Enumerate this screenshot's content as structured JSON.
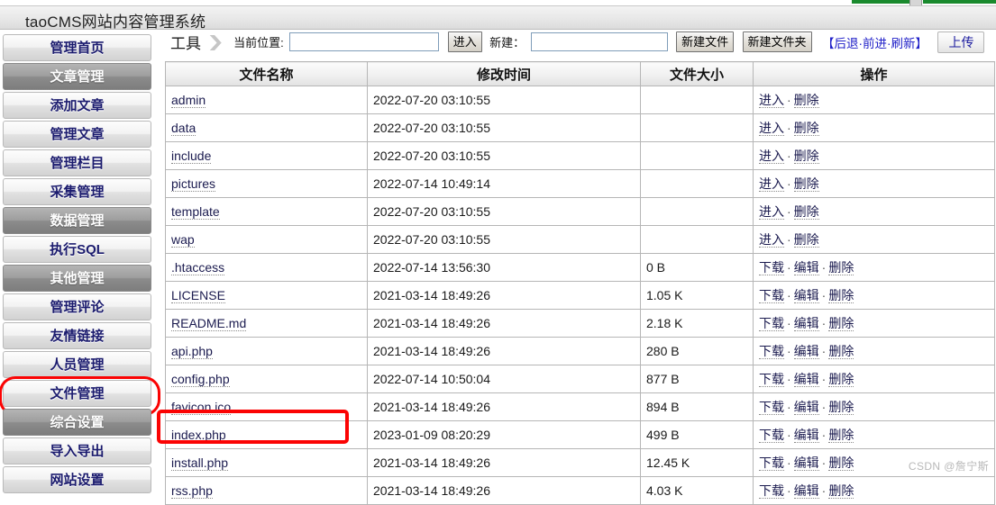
{
  "browser": {
    "tab_color": "#1a8a2e"
  },
  "app": {
    "title": "taoCMS网站内容管理系统"
  },
  "sidebar": {
    "items": [
      {
        "label": "管理首页",
        "type": "normal",
        "highlighted": false
      },
      {
        "label": "文章管理",
        "type": "group",
        "highlighted": false
      },
      {
        "label": "添加文章",
        "type": "normal",
        "highlighted": false
      },
      {
        "label": "管理文章",
        "type": "normal",
        "highlighted": false
      },
      {
        "label": "管理栏目",
        "type": "normal",
        "highlighted": false
      },
      {
        "label": "采集管理",
        "type": "normal",
        "highlighted": false
      },
      {
        "label": "数据管理",
        "type": "group",
        "highlighted": false
      },
      {
        "label": "执行SQL",
        "type": "normal",
        "highlighted": false
      },
      {
        "label": "其他管理",
        "type": "group",
        "highlighted": false
      },
      {
        "label": "管理评论",
        "type": "normal",
        "highlighted": false
      },
      {
        "label": "友情链接",
        "type": "normal",
        "highlighted": false
      },
      {
        "label": "人员管理",
        "type": "normal",
        "highlighted": false
      },
      {
        "label": "文件管理",
        "type": "normal",
        "highlighted": true
      },
      {
        "label": "综合设置",
        "type": "group",
        "highlighted": false
      },
      {
        "label": "导入导出",
        "type": "normal",
        "highlighted": false
      },
      {
        "label": "网站设置",
        "type": "normal",
        "highlighted": false
      }
    ]
  },
  "toolbar": {
    "tools_label": "工具",
    "separator": "❯",
    "location_label": "当前位置:",
    "location_value": "",
    "location_placeholder": "",
    "enter_button": "进入",
    "new_label": "新建：",
    "new_value": "",
    "new_placeholder": "",
    "new_file_button": "新建文件",
    "new_folder_button": "新建文件夹",
    "nav_links": "【后退·前进·刷新】",
    "upload_button": "上传"
  },
  "table": {
    "headers": [
      "文件名称",
      "修改时间",
      "文件大小",
      "操作"
    ],
    "dir_ops": [
      "进入",
      "删除"
    ],
    "file_ops": [
      "下载",
      "编辑",
      "删除"
    ],
    "op_dot": "·",
    "rows": [
      {
        "name": "admin",
        "time": "2022-07-20 03:10:55",
        "size": "",
        "kind": "dir",
        "highlighted": false
      },
      {
        "name": "data",
        "time": "2022-07-20 03:10:55",
        "size": "",
        "kind": "dir",
        "highlighted": false
      },
      {
        "name": "include",
        "time": "2022-07-20 03:10:55",
        "size": "",
        "kind": "dir",
        "highlighted": false
      },
      {
        "name": "pictures",
        "time": "2022-07-14 10:49:14",
        "size": "",
        "kind": "dir",
        "highlighted": false
      },
      {
        "name": "template",
        "time": "2022-07-20 03:10:55",
        "size": "",
        "kind": "dir",
        "highlighted": false
      },
      {
        "name": "wap",
        "time": "2022-07-20 03:10:55",
        "size": "",
        "kind": "dir",
        "highlighted": false
      },
      {
        "name": ".htaccess",
        "time": "2022-07-14 13:56:30",
        "size": "0 B",
        "kind": "file",
        "highlighted": false
      },
      {
        "name": "LICENSE",
        "time": "2021-03-14 18:49:26",
        "size": "1.05 K",
        "kind": "file",
        "highlighted": false
      },
      {
        "name": "README.md",
        "time": "2021-03-14 18:49:26",
        "size": "2.18 K",
        "kind": "file",
        "highlighted": false
      },
      {
        "name": "api.php",
        "time": "2021-03-14 18:49:26",
        "size": "280 B",
        "kind": "file",
        "highlighted": false
      },
      {
        "name": "config.php",
        "time": "2022-07-14 10:50:04",
        "size": "877 B",
        "kind": "file",
        "highlighted": false
      },
      {
        "name": "favicon.ico",
        "time": "2021-03-14 18:49:26",
        "size": "894 B",
        "kind": "file",
        "highlighted": false
      },
      {
        "name": "index.php",
        "time": "2023-01-09 08:20:29",
        "size": "499 B",
        "kind": "file",
        "highlighted": true
      },
      {
        "name": "install.php",
        "time": "2021-03-14 18:49:26",
        "size": "12.45 K",
        "kind": "file",
        "highlighted": false
      },
      {
        "name": "rss.php",
        "time": "2021-03-14 18:49:26",
        "size": "4.03 K",
        "kind": "file",
        "highlighted": false
      }
    ]
  },
  "watermark": {
    "text": "CSDN @詹宁斯"
  },
  "colors": {
    "highlight_red": "#fb0303",
    "link_blue": "#2020c8",
    "menu_text": "#1b1b6e"
  }
}
